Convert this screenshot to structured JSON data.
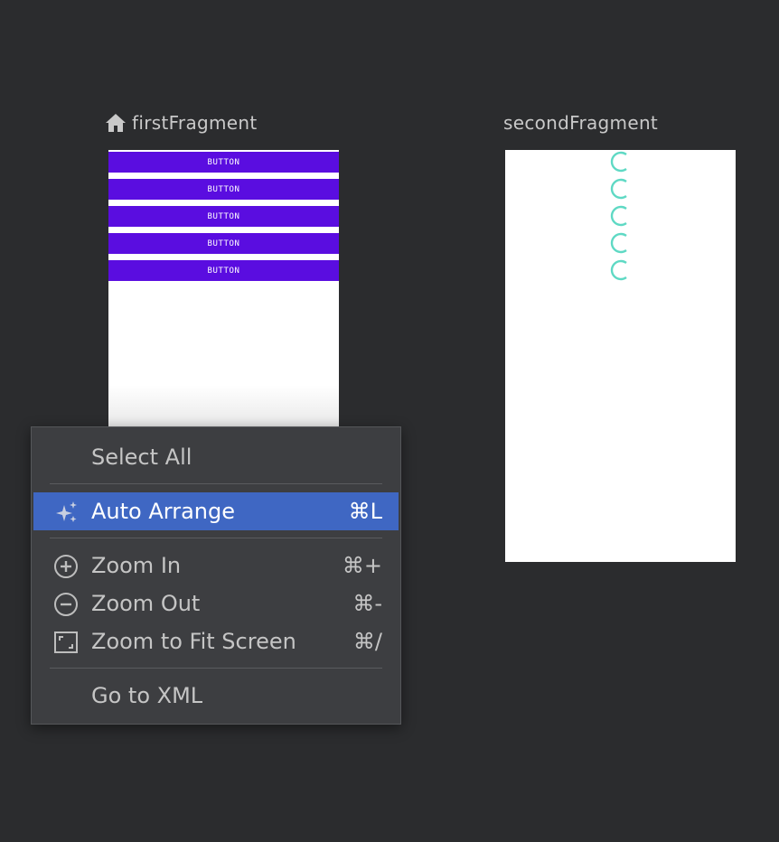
{
  "first_fragment": {
    "title": "firstFragment",
    "buttons": [
      "BUTTON",
      "BUTTON",
      "BUTTON",
      "BUTTON",
      "BUTTON"
    ]
  },
  "second_fragment": {
    "title": "secondFragment",
    "spinner_count": 5
  },
  "context_menu": {
    "select_all": "Select All",
    "auto_arrange": "Auto Arrange",
    "auto_arrange_shortcut": "⌘L",
    "zoom_in": "Zoom In",
    "zoom_in_shortcut": "⌘+",
    "zoom_out": "Zoom Out",
    "zoom_out_shortcut": "⌘-",
    "zoom_fit": "Zoom to Fit Screen",
    "zoom_fit_shortcut": "⌘/",
    "go_to_xml": "Go to XML"
  },
  "colors": {
    "canvas_bg": "#2b2c2e",
    "button_bg": "#5a0de0",
    "spinner": "#5fd9c4",
    "menu_bg": "#3d3e41",
    "menu_selected": "#3f67c3"
  },
  "icons": [
    "home-icon",
    "sparkle-icon",
    "zoom-in-icon",
    "zoom-out-icon",
    "zoom-fit-icon",
    "spinner-icon"
  ]
}
